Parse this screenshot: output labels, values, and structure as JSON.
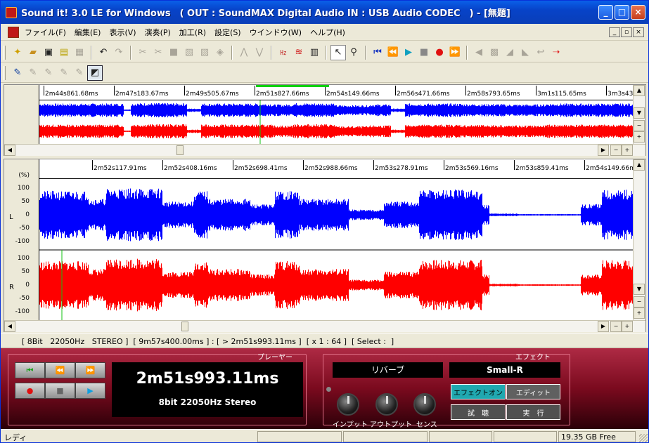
{
  "window": {
    "title": "Sound it! 3.0 LE for Windows　( OUT : SoundMAX Digital Audio  IN : USB Audio CODEC　) - [無題]"
  },
  "menu": [
    "ファイル(F)",
    "編集(E)",
    "表示(V)",
    "演奏(P)",
    "加工(R)",
    "設定(S)",
    "ウインドウ(W)",
    "ヘルプ(H)"
  ],
  "overview": {
    "ticks": [
      "2m44s861.68ms",
      "2m47s183.67ms",
      "2m49s505.67ms",
      "2m51s827.66ms",
      "2m54s149.66ms",
      "2m56s471.66ms",
      "2m58s793.65ms",
      "3m1s115.65ms",
      "3m3s437"
    ]
  },
  "detail": {
    "unit_label": "(%)",
    "ticks": [
      "2m52s117.91ms",
      "2m52s408.16ms",
      "2m52s698.41ms",
      "2m52s988.66ms",
      "2m53s278.91ms",
      "2m53s569.16ms",
      "2m53s859.41ms",
      "2m54s149.66ms"
    ],
    "axis": [
      "100",
      "50",
      "0",
      "-50",
      "-100"
    ],
    "channel_left": "L",
    "channel_right": "R"
  },
  "status_line": "[ 8Bit   22050Hz   STEREO ]  [ 9m57s400.00ms ] : [ > 2m51s993.11ms ]  [ x 1 : 64 ]  [ Select :  ]",
  "player": {
    "header": "プレーヤー",
    "time": "2m51s993.11ms",
    "format": "8bit 22050Hz Stereo"
  },
  "effect": {
    "header": "エフェクト",
    "name": "リバーブ",
    "preset": "Small-R",
    "on_label": "エフェクトオン",
    "edit_label": "エディット",
    "trial_label": "試　聴",
    "run_label": "実　行",
    "knobs": [
      "インプット",
      "アウトプット",
      "センス"
    ]
  },
  "statusbar": {
    "ready": "レディ",
    "free": "19.35 GB Free"
  },
  "colors": {
    "left_wave": "#0000FF",
    "right_wave": "#FF0000"
  }
}
